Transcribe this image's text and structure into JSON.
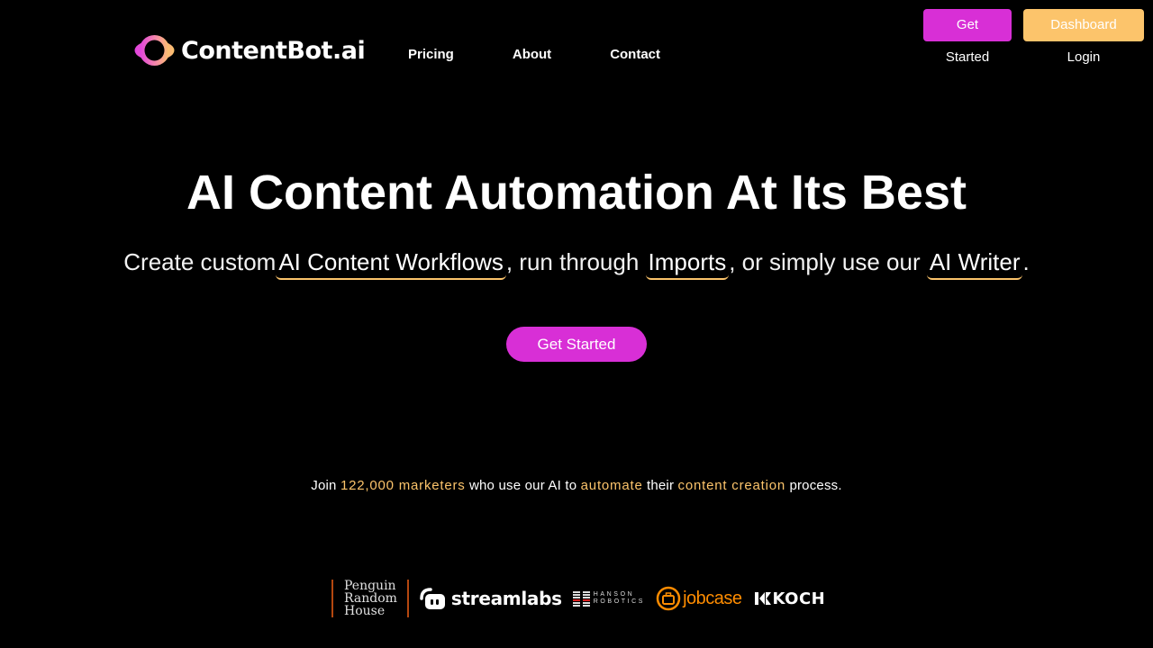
{
  "header": {
    "logo_text": "ContentBot.ai",
    "nav": [
      {
        "label": "Pricing"
      },
      {
        "label": "About"
      },
      {
        "label": "Contact"
      }
    ],
    "top_buttons": {
      "get_started": "Get Started",
      "dashboard_login": "Dashboard Login"
    }
  },
  "hero": {
    "title": "AI Content Automation At Its Best",
    "subtitle": {
      "part1": "Create custom",
      "link1": "AI Content Workflows",
      "part2": ", run through ",
      "link2": "Imports",
      "part3": ", or simply use our ",
      "link3": "AI Writer",
      "part4": "."
    },
    "cta_label": "Get Started"
  },
  "social_proof": {
    "join": "Join ",
    "count": "122,000 marketers",
    "mid1": " who use our AI to ",
    "verb": "automate",
    "mid2": " their ",
    "object": "content creation",
    "end": " process."
  },
  "client_logos": [
    {
      "name": "Penguin Random House",
      "lines": [
        "Penguin",
        "Random",
        "House"
      ]
    },
    {
      "name": "streamlabs",
      "text": "streamlabs"
    },
    {
      "name": "Hanson Robotics",
      "lines": [
        "HANSON",
        "ROBOTICS"
      ]
    },
    {
      "name": "jobcase",
      "text": "jobcase"
    },
    {
      "name": "Koch",
      "text": "KOCH"
    }
  ],
  "colors": {
    "background": "#000000",
    "primary_pink": "#d82fd6",
    "accent_orange": "#fcc46b",
    "text": "#ffffff"
  }
}
